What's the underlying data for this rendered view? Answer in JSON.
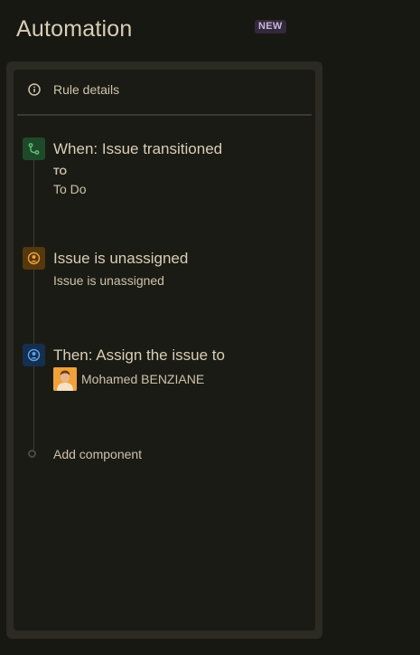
{
  "header": {
    "title": "Automation",
    "badge": "NEW"
  },
  "panel": {
    "rule_details_label": "Rule details",
    "steps": [
      {
        "icon": "branch-icon",
        "title": "When: Issue transitioned",
        "caps": "TO",
        "detail": "To Do",
        "color": "#1f4a2a"
      },
      {
        "icon": "user-unassigned-icon",
        "title": "Issue is unassigned",
        "detail": "Issue is unassigned",
        "color": "#55380d"
      },
      {
        "icon": "user-assign-icon",
        "title": "Then: Assign the issue to",
        "assignee": "Mohamed BENZIANE",
        "color": "#142f4f"
      }
    ],
    "add_component_label": "Add component"
  },
  "colors": {
    "background": "#181812",
    "panel": "#1b1b15",
    "badge_bg": "#34283c",
    "text": "#d8cdb7"
  }
}
